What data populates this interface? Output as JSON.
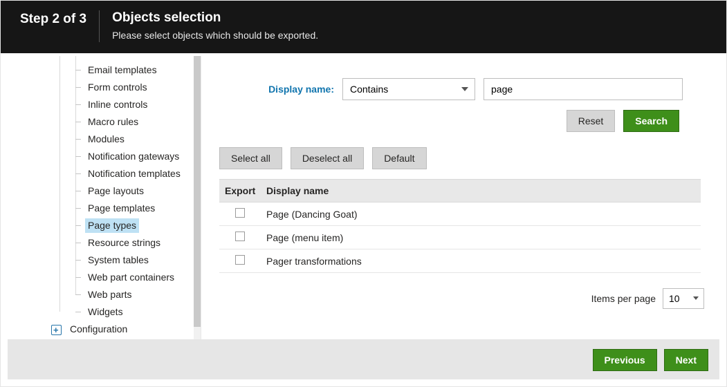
{
  "header": {
    "step": "Step 2 of 3",
    "title": "Objects selection",
    "subtitle": "Please select objects which should be exported."
  },
  "sidebar": {
    "items": [
      {
        "label": "Email templates",
        "selected": false
      },
      {
        "label": "Form controls",
        "selected": false
      },
      {
        "label": "Inline controls",
        "selected": false
      },
      {
        "label": "Macro rules",
        "selected": false
      },
      {
        "label": "Modules",
        "selected": false
      },
      {
        "label": "Notification gateways",
        "selected": false
      },
      {
        "label": "Notification templates",
        "selected": false
      },
      {
        "label": "Page layouts",
        "selected": false
      },
      {
        "label": "Page templates",
        "selected": false
      },
      {
        "label": "Page types",
        "selected": true
      },
      {
        "label": "Resource strings",
        "selected": false
      },
      {
        "label": "System tables",
        "selected": false
      },
      {
        "label": "Web part containers",
        "selected": false
      },
      {
        "label": "Web parts",
        "selected": false
      },
      {
        "label": "Widgets",
        "selected": false
      }
    ],
    "config_label": "Configuration"
  },
  "filter": {
    "label": "Display name:",
    "operator_selected": "Contains",
    "value": "page",
    "reset_label": "Reset",
    "search_label": "Search"
  },
  "selection_buttons": {
    "select_all": "Select all",
    "deselect_all": "Deselect all",
    "default": "Default"
  },
  "table": {
    "headers": {
      "export": "Export",
      "display_name": "Display name"
    },
    "rows": [
      {
        "checked": false,
        "name": "Page (Dancing Goat)"
      },
      {
        "checked": false,
        "name": "Page (menu item)"
      },
      {
        "checked": false,
        "name": "Pager transformations"
      }
    ]
  },
  "pager": {
    "items_per_page_label": "Items per page",
    "items_per_page_value": "10"
  },
  "footer": {
    "previous": "Previous",
    "next": "Next"
  }
}
